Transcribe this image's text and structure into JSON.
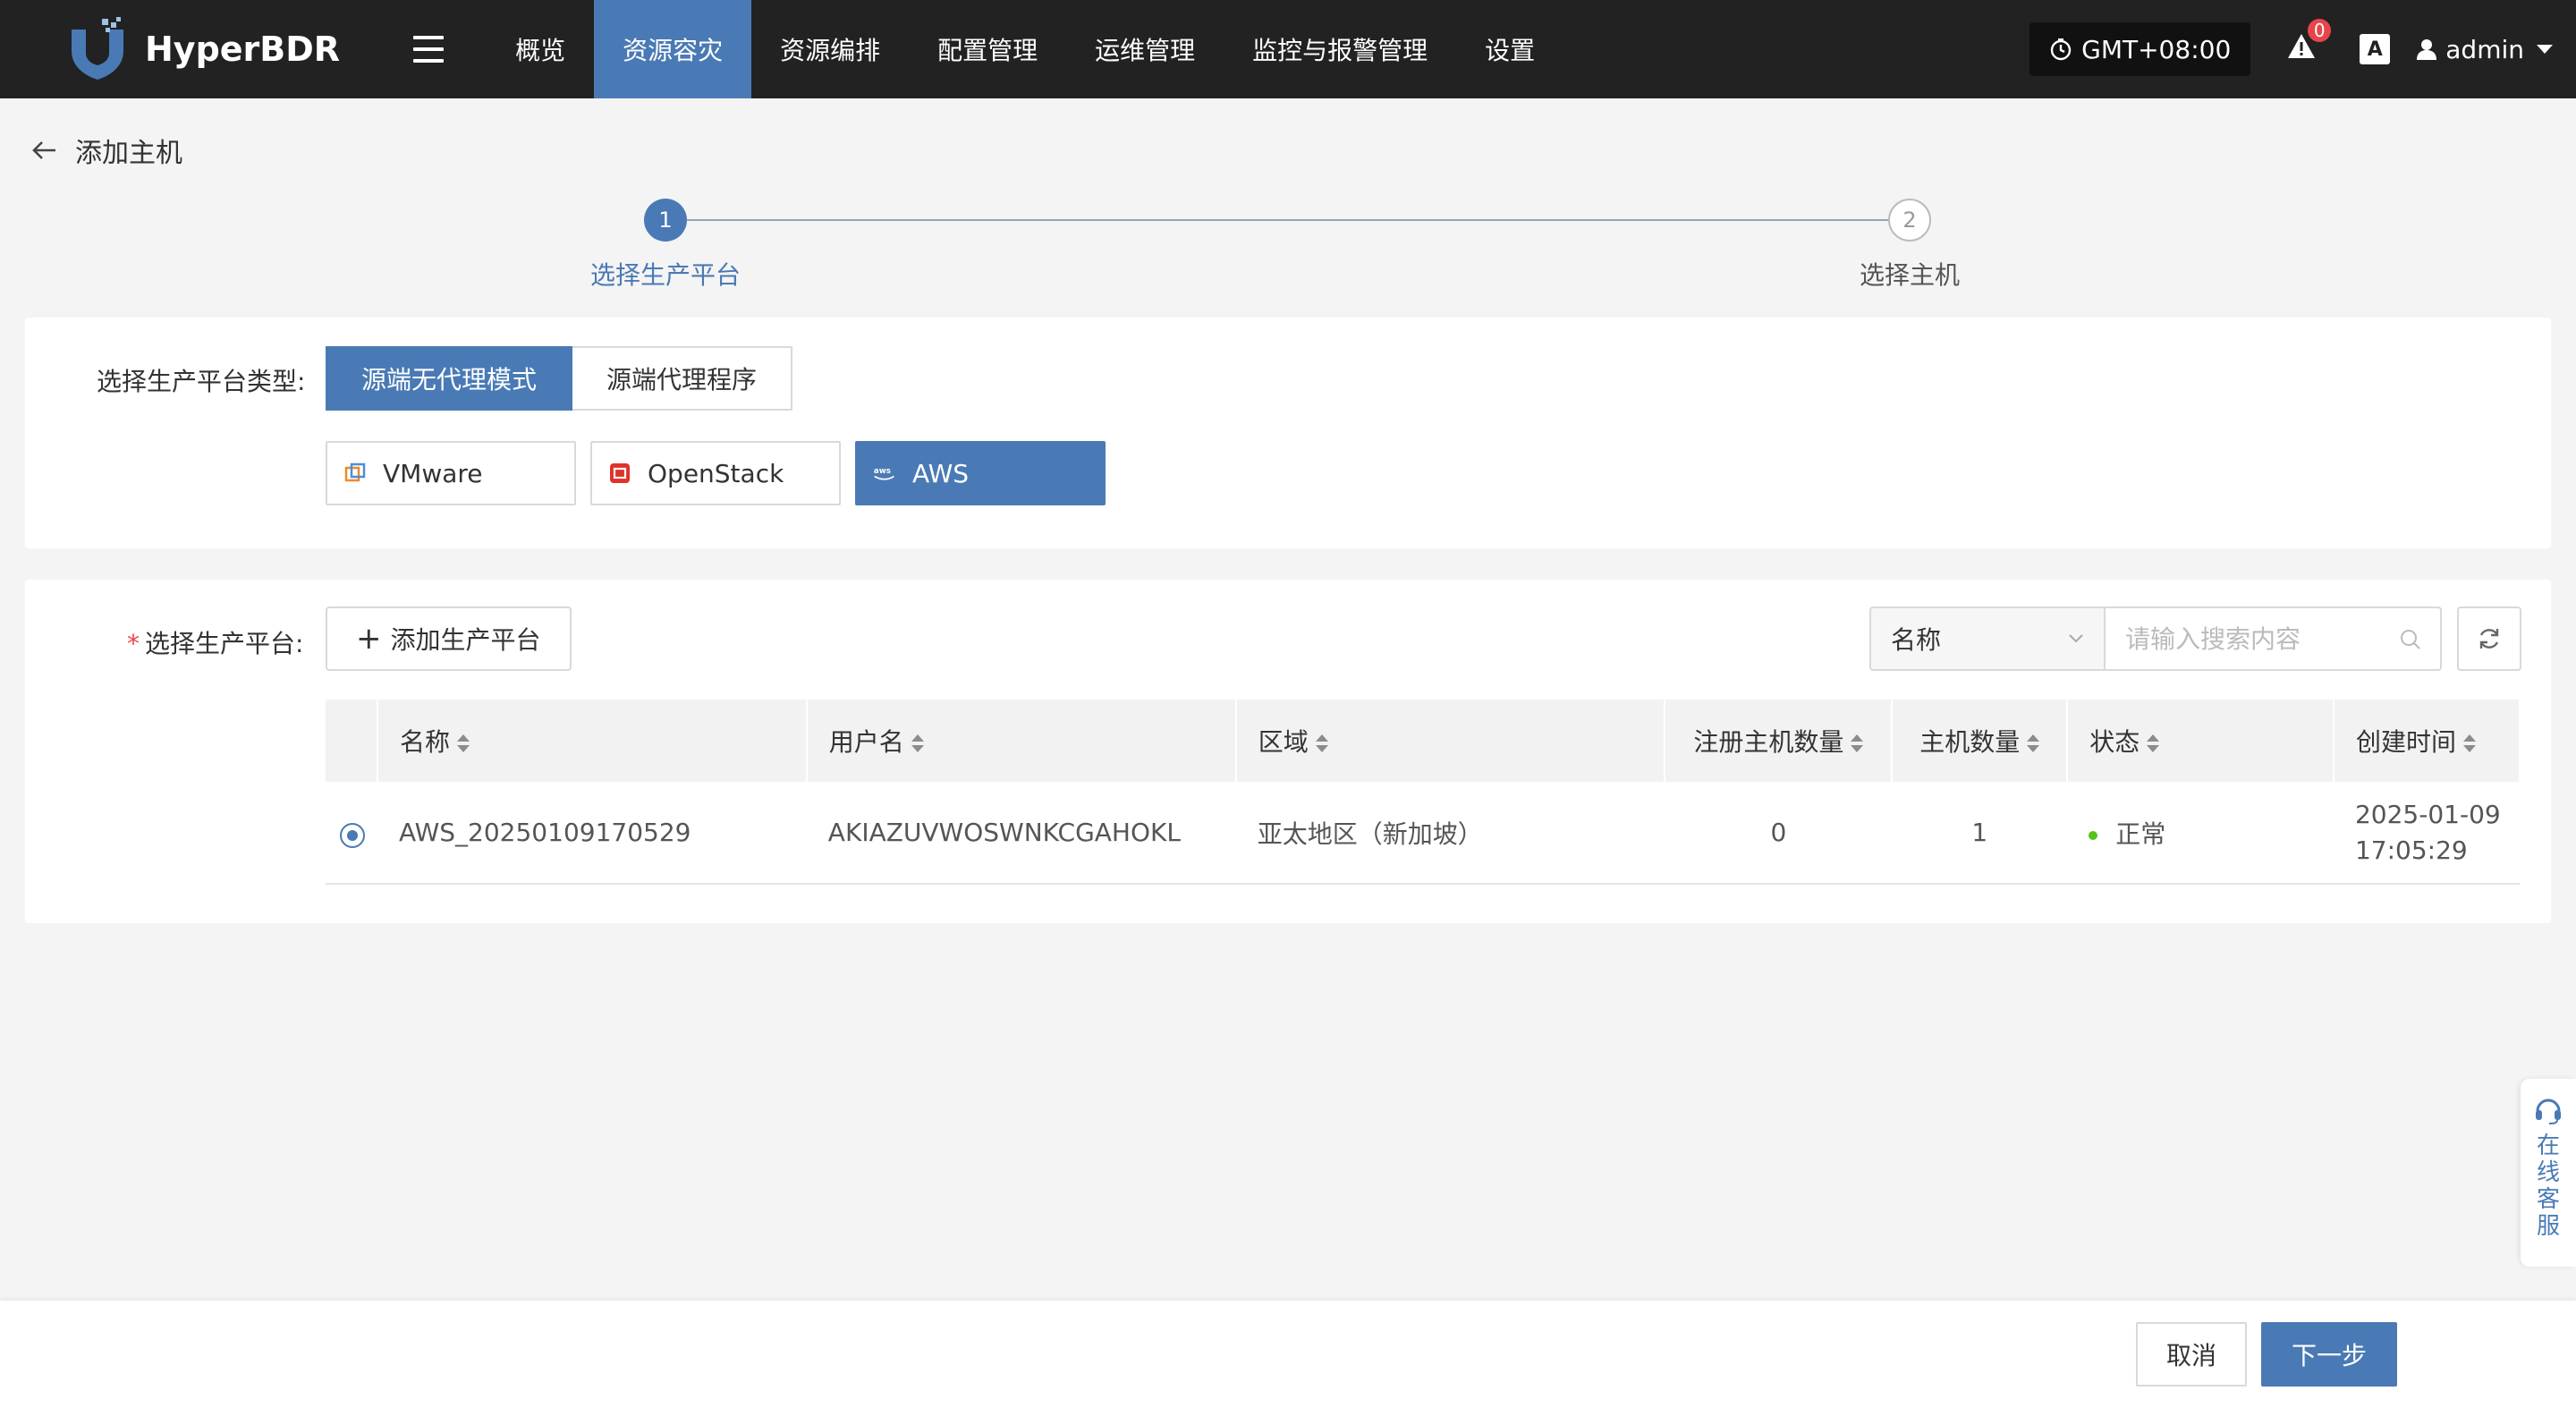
{
  "app": {
    "name": "HyperBDR"
  },
  "nav": {
    "items": [
      {
        "label": "概览",
        "active": false
      },
      {
        "label": "资源容灾",
        "active": true
      },
      {
        "label": "资源编排",
        "active": false
      },
      {
        "label": "配置管理",
        "active": false
      },
      {
        "label": "运维管理",
        "active": false
      },
      {
        "label": "监控与报警管理",
        "active": false
      },
      {
        "label": "设置",
        "active": false
      }
    ]
  },
  "topright": {
    "timezone": "GMT+08:00",
    "alert_count": "0",
    "lang_icon": "A",
    "user": "admin"
  },
  "page": {
    "title": "添加主机"
  },
  "steps": [
    {
      "num": "1",
      "label": "选择生产平台",
      "status": "active"
    },
    {
      "num": "2",
      "label": "选择主机",
      "status": "pending"
    }
  ],
  "platform_type": {
    "label": "选择生产平台类型:",
    "modes": [
      {
        "label": "源端无代理模式",
        "active": true
      },
      {
        "label": "源端代理程序",
        "active": false
      }
    ],
    "platforms": [
      {
        "label": "VMware",
        "icon": "vmware-icon",
        "active": false
      },
      {
        "label": "OpenStack",
        "icon": "openstack-icon",
        "active": false
      },
      {
        "label": "AWS",
        "icon": "aws-icon",
        "active": true
      }
    ]
  },
  "platform_select": {
    "required_mark": "*",
    "label": "选择生产平台:",
    "add_button": "添加生产平台",
    "search": {
      "field": "名称",
      "placeholder": "请输入搜索内容"
    },
    "columns": [
      "名称",
      "用户名",
      "区域",
      "注册主机数量",
      "主机数量",
      "状态",
      "创建时间"
    ],
    "rows": [
      {
        "selected": true,
        "name": "AWS_20250109170529",
        "username": "AKIAZUVWOSWNKCGAHOKL",
        "region": "亚太地区（新加坡）",
        "registered_hosts": "0",
        "hosts": "1",
        "status": "正常",
        "created_date": "2025-01-09",
        "created_time": "17:05:29"
      }
    ]
  },
  "footer": {
    "cancel": "取消",
    "next": "下一步"
  },
  "support": {
    "label": "在线客服"
  },
  "colors": {
    "primary": "#4a7ab5",
    "nav_bg": "#222222",
    "success": "#52c41a",
    "danger": "#e8454b"
  }
}
